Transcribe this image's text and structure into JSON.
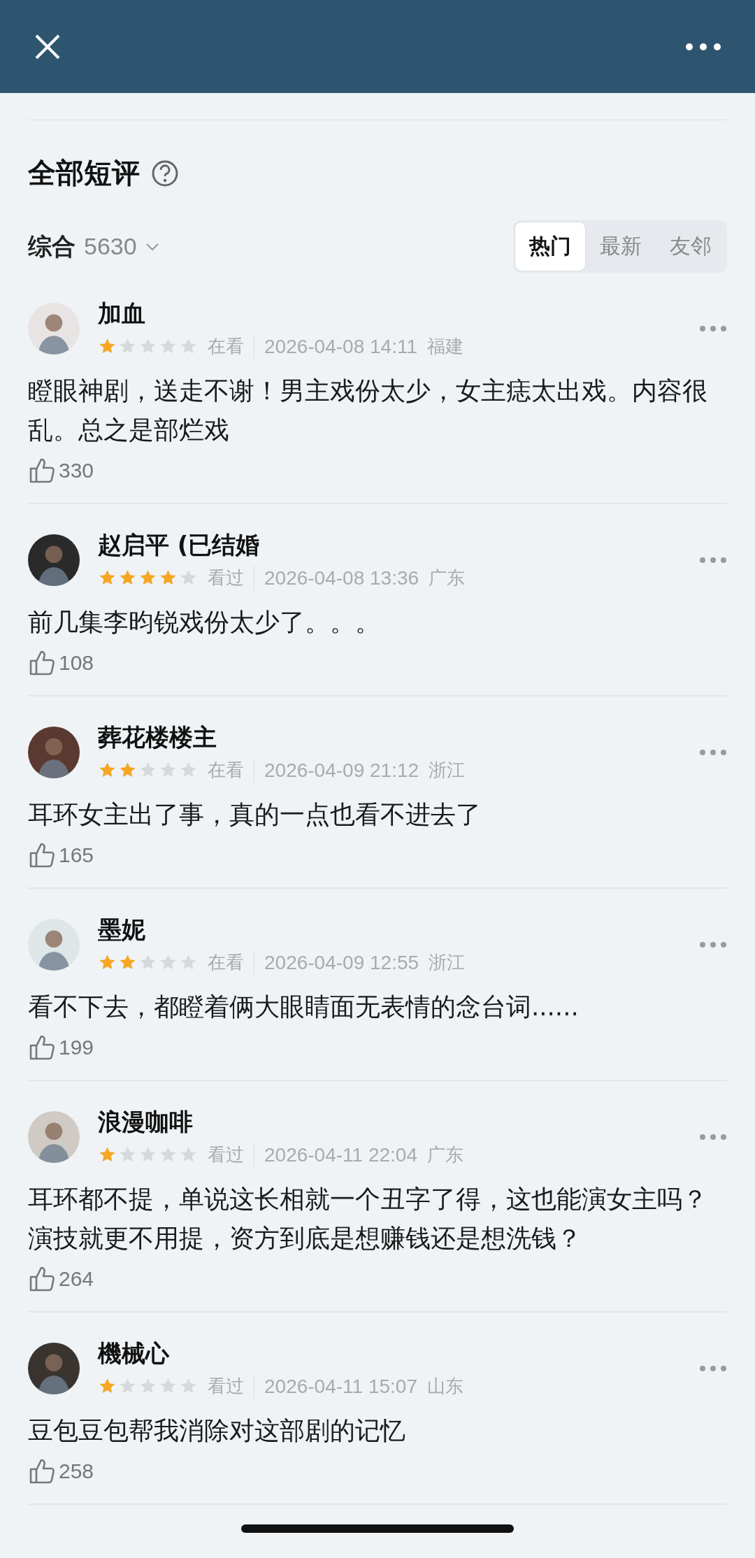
{
  "section": {
    "title": "全部短评",
    "sort_label": "综合",
    "count": "5630"
  },
  "tabs": [
    {
      "label": "热门",
      "selected": true
    },
    {
      "label": "最新",
      "selected": false
    },
    {
      "label": "友邻",
      "selected": false
    }
  ],
  "reviews": [
    {
      "user": "加血",
      "stars": 1,
      "status": "在看",
      "time": "2026-04-08 14:11",
      "location": "福建",
      "text": "瞪眼神剧，送走不谢！男主戏份太少，女主痣太出戏。内容很乱。总之是部烂戏",
      "likes": "330"
    },
    {
      "user": "赵启平 (已结婚",
      "stars": 4,
      "status": "看过",
      "time": "2026-04-08 13:36",
      "location": "广东",
      "text": "前几集李昀锐戏份太少了。。。",
      "likes": "108"
    },
    {
      "user": "葬花楼楼主",
      "stars": 2,
      "status": "在看",
      "time": "2026-04-09 21:12",
      "location": "浙江",
      "text": "耳环女主出了事，真的一点也看不进去了",
      "likes": "165"
    },
    {
      "user": "墨妮",
      "stars": 2,
      "status": "在看",
      "time": "2026-04-09 12:55",
      "location": "浙江",
      "text": "看不下去，都瞪着俩大眼睛面无表情的念台词......",
      "likes": "199"
    },
    {
      "user": "浪漫咖啡",
      "stars": 1,
      "status": "看过",
      "time": "2026-04-11 22:04",
      "location": "广东",
      "text": "耳环都不提，单说这长相就一个丑字了得，这也能演女主吗？演技就更不用提，资方到底是想赚钱还是想洗钱？",
      "likes": "264"
    },
    {
      "user": "機械心",
      "stars": 1,
      "status": "看过",
      "time": "2026-04-11 15:07",
      "location": "山东",
      "text": "豆包豆包帮我消除对这部剧的记忆",
      "likes": "258"
    }
  ]
}
